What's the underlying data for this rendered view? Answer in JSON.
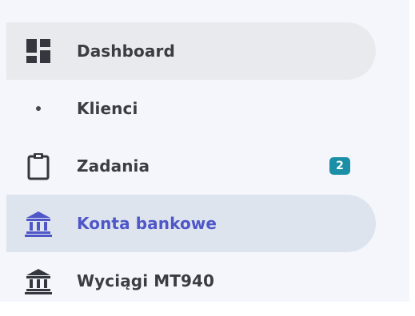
{
  "colors": {
    "panel_bg": "#f4f6fb",
    "text": "#3b3d42",
    "active_text": "#4f57c8",
    "hover_bg": "#e8eaee",
    "active_bg": "#dde4ee",
    "badge_bg": "#1b8fa6"
  },
  "sidebar": {
    "items": [
      {
        "label": "Dashboard",
        "icon": "dashboard-icon",
        "state": "hover"
      },
      {
        "label": "Klienci",
        "icon": "bullet-dot-icon",
        "state": "normal"
      },
      {
        "label": "Zadania",
        "icon": "clipboard-icon",
        "state": "normal",
        "badge": "2"
      },
      {
        "label": "Konta bankowe",
        "icon": "bank-icon",
        "state": "active"
      },
      {
        "label": "Wyciągi MT940",
        "icon": "bank-icon",
        "state": "normal"
      }
    ]
  }
}
